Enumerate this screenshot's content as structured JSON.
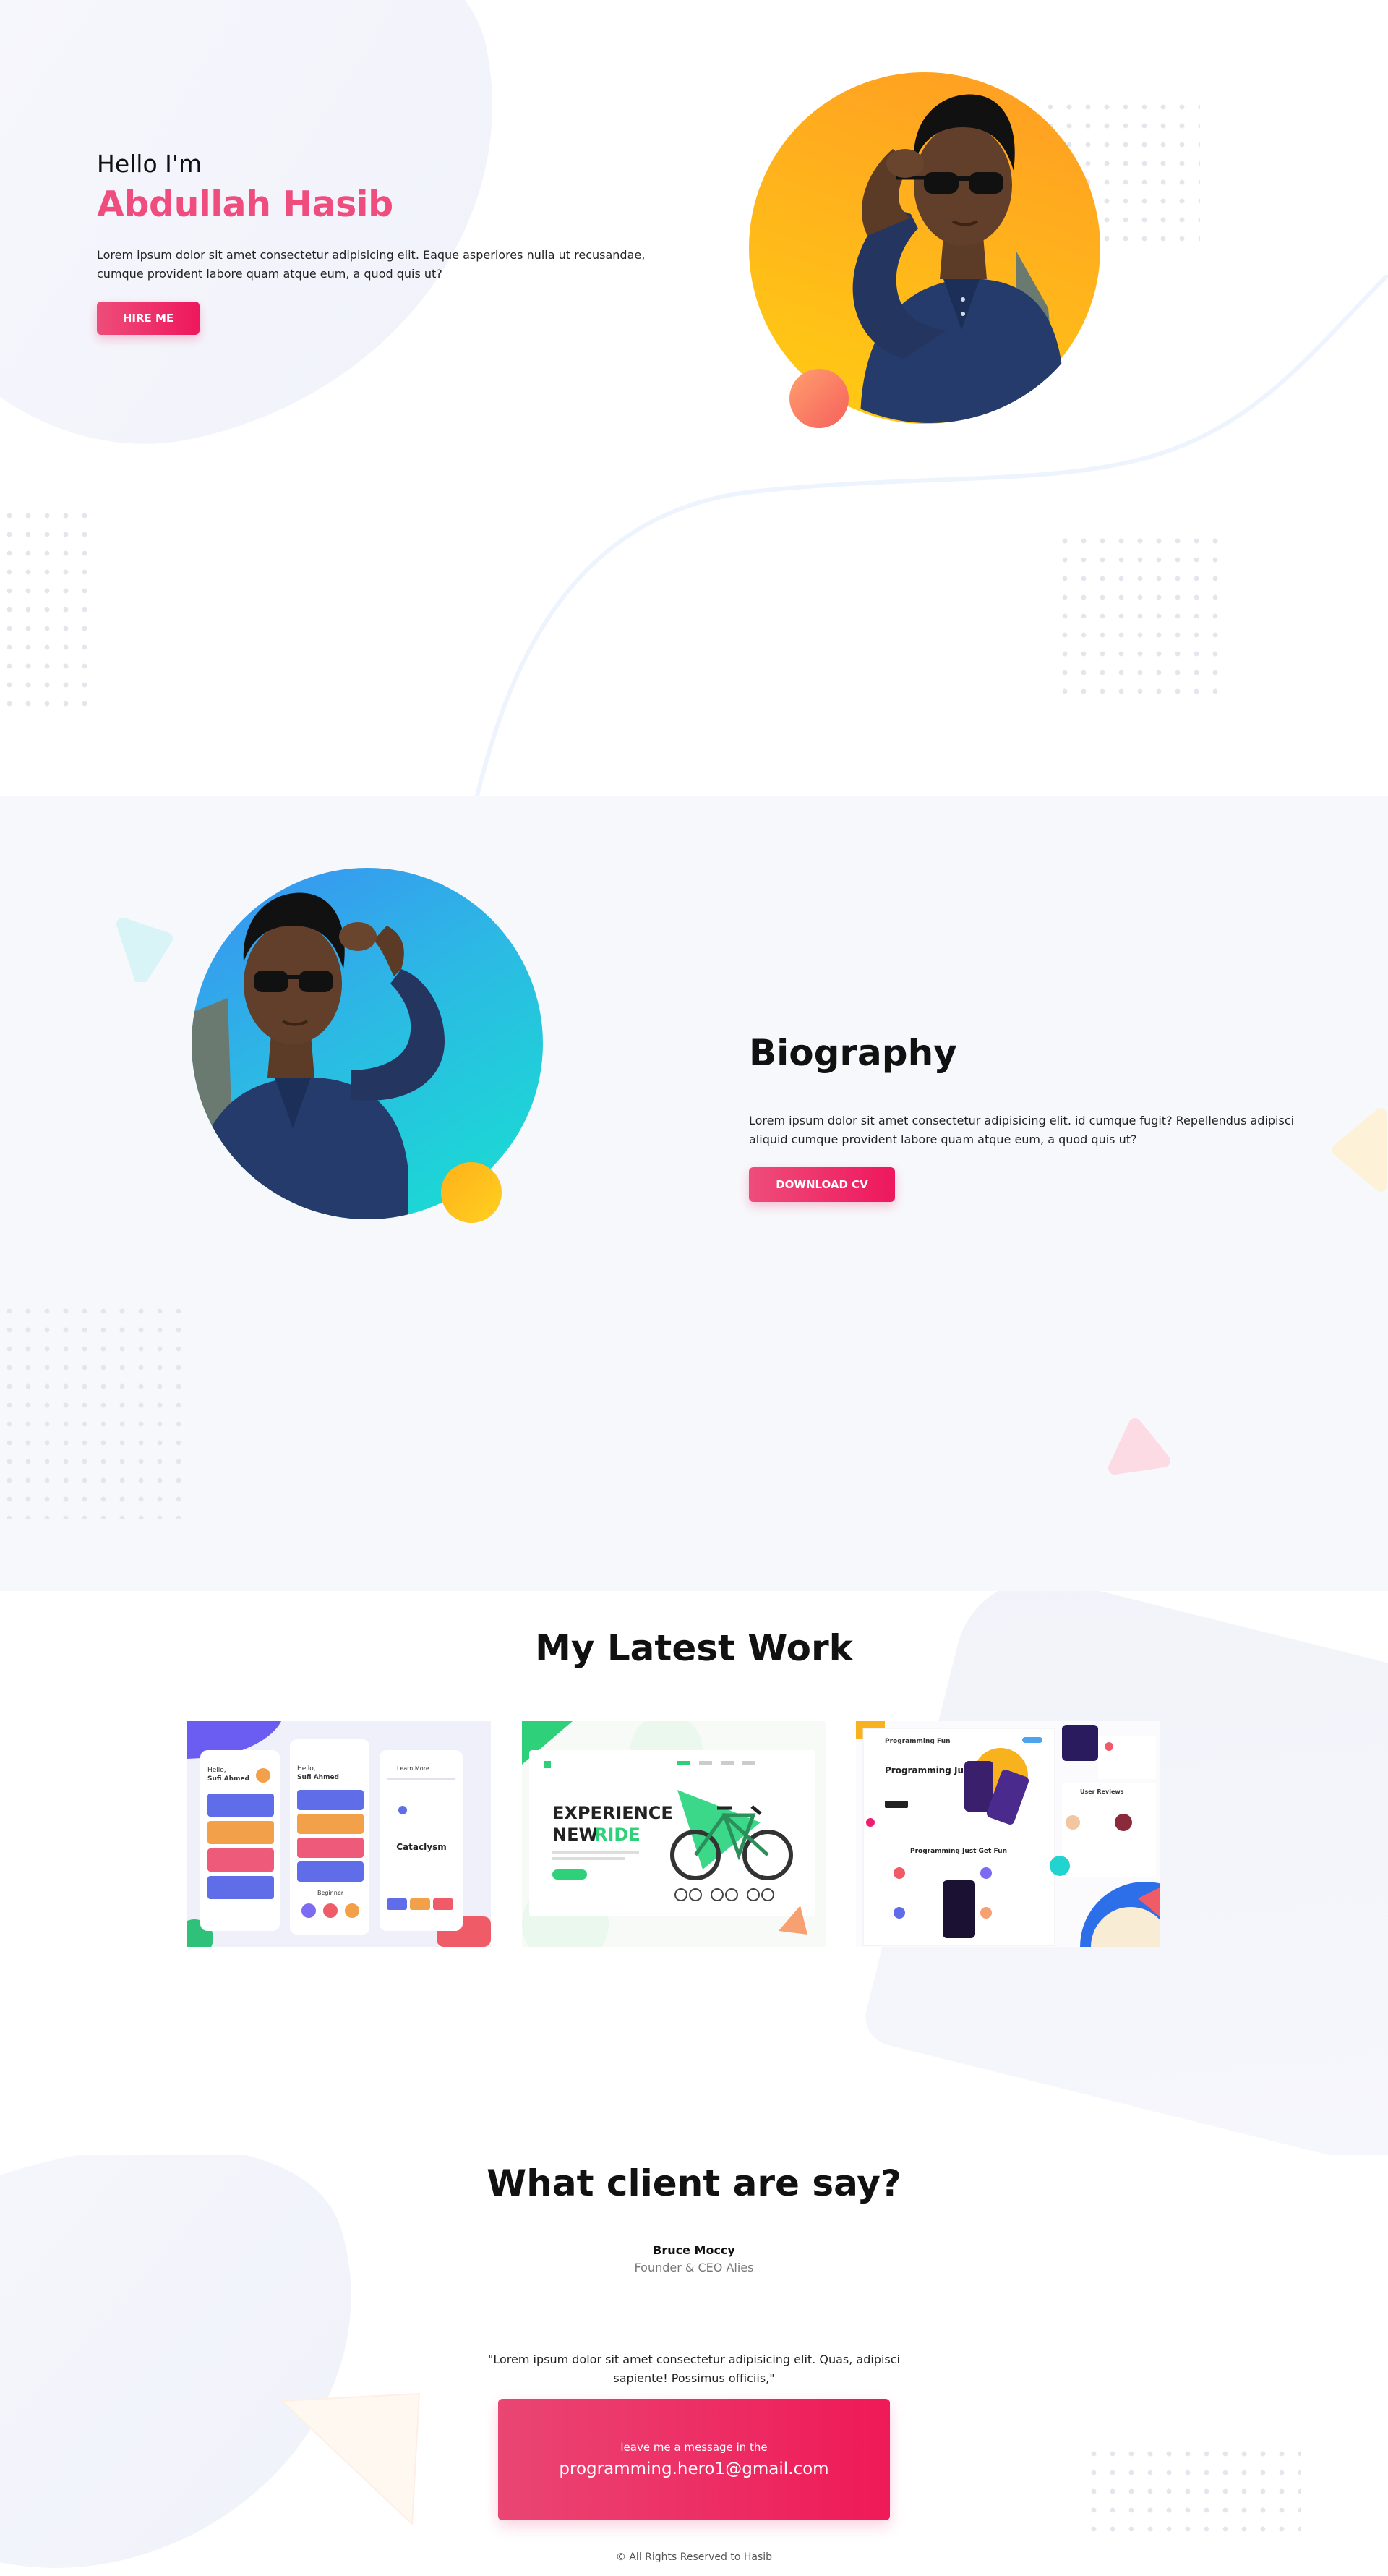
{
  "hero": {
    "greeting": "Hello I'm",
    "name": "Abdullah Hasib",
    "description": "Lorem ipsum dolor sit amet consectetur adipisicing elit. Eaque asperiores nulla ut recusandae, cumque provident labore quam atque eum, a quod quis ut?",
    "cta_label": "HIRE ME"
  },
  "biography": {
    "title": "Biography",
    "description": "Lorem ipsum dolor sit amet consectetur adipisicing elit. id cumque fugit? Repellendus adipisci aliquid cumque provident labore quam atque eum, a quod quis ut?",
    "cta_label": "DOWNLOAD CV"
  },
  "work": {
    "title": "My Latest Work",
    "cards": [
      {
        "greeting": "Hello,",
        "name": "Sufi Ahmed",
        "detail_back": "Learn More",
        "detail_title": "Cataclysm",
        "list_label": "Beginner",
        "bottom_label": "Beginner"
      },
      {
        "headline_1": "EXPERIENCE",
        "headline_2": "NEW",
        "headline_accent": "RIDE"
      },
      {
        "brand": "Programming Fun",
        "headline": "Programming Just Get Fun",
        "section_label": "Programming Just Get Fun",
        "reviews_label": "User Reviews"
      }
    ]
  },
  "testimonial": {
    "title": "What client are say?",
    "client_name": "Bruce Moccy",
    "client_role": "Founder & CEO Alies",
    "quote": "\"Lorem ipsum dolor sit amet consectetur adipisicing elit. Quas, adipisci sapiente! Possimus officiis,\"",
    "contact_label": "leave me a message in the",
    "contact_email": "programming.hero1@gmail.com"
  },
  "footer": {
    "copyright": "© All Rights Reserved to Hasib"
  },
  "colors": {
    "accent": "#ee4d7e",
    "button": "#ee175d",
    "hero_circle": "#ffb21c",
    "bio_circle": "#17e0d0"
  }
}
